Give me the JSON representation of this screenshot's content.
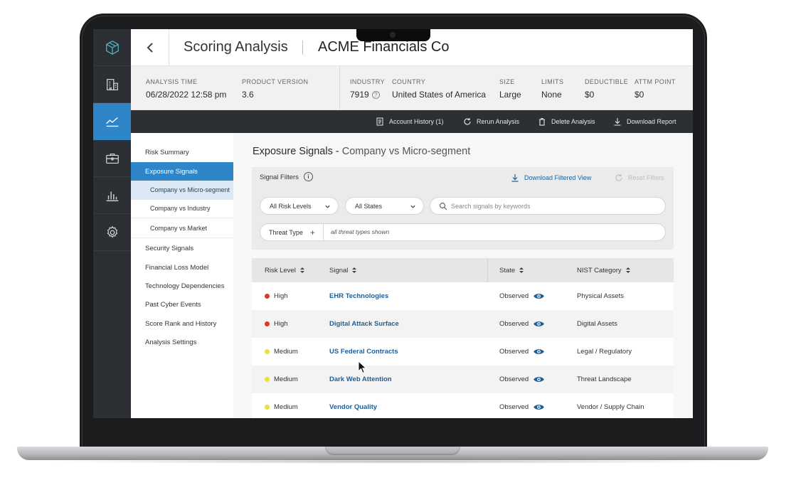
{
  "header": {
    "back_label": "<",
    "title": "Scoring Analysis",
    "company": "ACME Financials Co"
  },
  "rail": {
    "items": [
      {
        "icon": "logo-cube-icon"
      },
      {
        "icon": "building-icon"
      },
      {
        "icon": "line-chart-icon",
        "active": true
      },
      {
        "icon": "briefcase-icon"
      },
      {
        "icon": "bar-chart-icon"
      },
      {
        "icon": "gear-icon"
      }
    ]
  },
  "info": {
    "analysis_time_label": "ANALYSIS TIME",
    "analysis_time_value": "06/28/2022  12:58 pm",
    "product_version_label": "PRODUCT VERSION",
    "product_version_value": "3.6",
    "industry_label": "INDUSTRY",
    "industry_value": "7919",
    "industry_help": "?",
    "country_label": "COUNTRY",
    "country_value": "United States of America",
    "size_label": "SIZE",
    "size_value": "Large",
    "limits_label": "LIMITS",
    "limits_value": "None",
    "deductible_label": "DEDUCTIBLE",
    "deductible_value": "$0",
    "attm_label": "ATTM POINT",
    "attm_value": "$0"
  },
  "actions": {
    "account_history": "Account History (1)",
    "rerun": "Rerun Analysis",
    "delete": "Delete Analysis",
    "download": "Download Report"
  },
  "subnav": {
    "items": [
      {
        "label": "Risk Summary"
      },
      {
        "label": "Exposure Signals",
        "active": true
      },
      {
        "label": "Company vs Micro-segment",
        "sub": true,
        "active": true
      },
      {
        "label": "Company vs Industry",
        "sub": true
      },
      {
        "label": "Company vs Market",
        "sub": true
      },
      {
        "label": "Security Signals"
      },
      {
        "label": "Financial Loss Model"
      },
      {
        "label": "Technology Dependencies"
      },
      {
        "label": "Past Cyber Events"
      },
      {
        "label": "Score Rank and History"
      },
      {
        "label": "Analysis Settings"
      }
    ]
  },
  "content": {
    "title": "Exposure Signals",
    "title_sep": " - ",
    "subtitle": "Company vs Micro-segment"
  },
  "filters": {
    "label": "Signal Filters",
    "info_glyph": "i",
    "download_filtered": "Download Filtered View",
    "reset": "Reset Filters",
    "risk_level_value": "All Risk Levels",
    "states_value": "All States",
    "search_placeholder": "Search signals by keywords",
    "search_value": "",
    "threat_type_label": "Threat Type",
    "threat_type_plus": "+",
    "threat_type_summary": "all threat types shown"
  },
  "table": {
    "columns": [
      "Risk Level",
      "Signal",
      "State",
      "NIST Category"
    ],
    "rows": [
      {
        "risk": "High",
        "risk_color": "#d93a2b",
        "signal": "EHR Technologies",
        "state": "Observed",
        "nist": "Physical Assets"
      },
      {
        "risk": "High",
        "risk_color": "#d93a2b",
        "signal": "Digital Attack Surface",
        "state": "Observed",
        "nist": "Digital Assets"
      },
      {
        "risk": "Medium",
        "risk_color": "#e8e23a",
        "signal": "US Federal Contracts",
        "state": "Observed",
        "nist": "Legal / Regulatory"
      },
      {
        "risk": "Medium",
        "risk_color": "#e8e23a",
        "signal": "Dark Web Attention",
        "state": "Observed",
        "nist": "Threat Landscape"
      },
      {
        "risk": "Medium",
        "risk_color": "#e8e23a",
        "signal": "Vendor Quality",
        "state": "Observed",
        "nist": "Vendor / Supply Chain"
      }
    ]
  },
  "colors": {
    "accent": "#2e86c9",
    "rail_bg": "#2c2f33",
    "link": "#1f5f96",
    "risk_high": "#d93a2b",
    "risk_medium": "#e8e23a"
  }
}
